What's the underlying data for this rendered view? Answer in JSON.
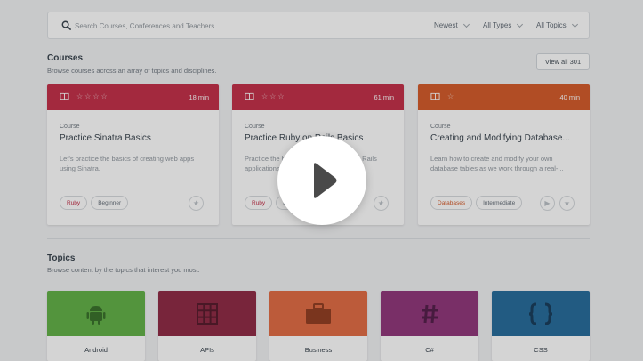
{
  "search": {
    "placeholder": "Search Courses, Conferences and Teachers..."
  },
  "filters": [
    {
      "label": "Newest"
    },
    {
      "label": "All Types"
    },
    {
      "label": "All Topics"
    }
  ],
  "courses_section": {
    "title": "Courses",
    "subtitle": "Browse courses across an array of topics and disciplines.",
    "view_all_label": "View all 301"
  },
  "courses": [
    {
      "accent": "#c0253f",
      "duration": "18 min",
      "kind": "Course",
      "title": "Practice Sinatra Basics",
      "description": "Let's practice the basics of creating web apps using Sinatra.",
      "tags": [
        "Ruby",
        "Beginner"
      ],
      "tag_accent": "#c0253f",
      "star_count": 4
    },
    {
      "accent": "#c0253f",
      "duration": "61 min",
      "kind": "Course",
      "title": "Practice Ruby on Rails Basics",
      "description": "Practice the basics of creating Ruby on Rails applications.",
      "tags": [
        "Ruby",
        "Beginner"
      ],
      "tag_accent": "#c0253f",
      "star_count": 3
    },
    {
      "accent": "#d2521f",
      "duration": "40 min",
      "kind": "Course",
      "title": "Creating and Modifying Database...",
      "description": "Learn how to create and modify your own database tables as we work through a real-...",
      "tags": [
        "Databases",
        "Intermediate"
      ],
      "tag_accent": "#d2521f",
      "star_count": 1
    }
  ],
  "topics_section": {
    "title": "Topics",
    "subtitle": "Browse content by the topics that interest you most."
  },
  "topics": [
    {
      "label": "Android",
      "color": "#5aad3e",
      "icon": "android-icon"
    },
    {
      "label": "APIs",
      "color": "#8a1f3b",
      "icon": "grid-icon"
    },
    {
      "label": "Business",
      "color": "#e0643a",
      "icon": "briefcase-icon"
    },
    {
      "label": "C#",
      "color": "#8b2c74",
      "icon": "hash-icon"
    },
    {
      "label": "CSS",
      "color": "#1c6596",
      "icon": "braces-icon"
    }
  ],
  "video": {
    "icon": "play-icon"
  }
}
